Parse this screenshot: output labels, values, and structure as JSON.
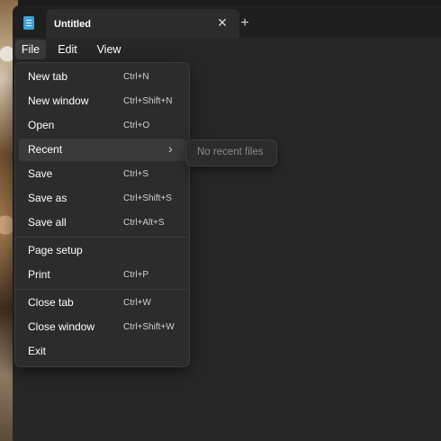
{
  "window": {
    "tab_title": "Untitled",
    "tab_close_glyph": "✕",
    "new_tab_glyph": "+"
  },
  "menubar": {
    "file": "File",
    "edit": "Edit",
    "view": "View"
  },
  "file_menu": {
    "items": [
      {
        "label": "New tab",
        "shortcut": "Ctrl+N"
      },
      {
        "label": "New window",
        "shortcut": "Ctrl+Shift+N"
      },
      {
        "label": "Open",
        "shortcut": "Ctrl+O"
      },
      {
        "label": "Recent",
        "shortcut": ""
      },
      {
        "label": "Save",
        "shortcut": "Ctrl+S"
      },
      {
        "label": "Save as",
        "shortcut": "Ctrl+Shift+S"
      },
      {
        "label": "Save all",
        "shortcut": "Ctrl+Alt+S"
      },
      {
        "label": "Page setup",
        "shortcut": ""
      },
      {
        "label": "Print",
        "shortcut": "Ctrl+P"
      },
      {
        "label": "Close tab",
        "shortcut": "Ctrl+W"
      },
      {
        "label": "Close window",
        "shortcut": "Ctrl+Shift+W"
      },
      {
        "label": "Exit",
        "shortcut": ""
      }
    ],
    "recent_chevron": "›"
  },
  "recent_submenu": {
    "empty_text": "No recent files"
  },
  "icons": {
    "app": "notepad-icon",
    "close": "close-icon",
    "add": "plus-icon",
    "submenu": "chevron-right-icon"
  },
  "colors": {
    "window_bg": "#272727",
    "titlebar_bg": "#1f1f1f",
    "menu_bg": "#2c2c2c",
    "hover_bg": "#3a3a3a",
    "text": "#ffffff",
    "muted_text": "#8a8a8a",
    "accent_icon": "#3fa0d8"
  }
}
